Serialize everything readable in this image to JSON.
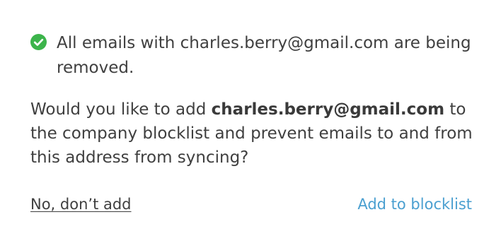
{
  "status": {
    "icon": "check-circle-icon",
    "icon_color": "#3cb44b",
    "message": "All emails with charles.berry@gmail.com are being removed."
  },
  "prompt": {
    "prefix": "Would you like to add ",
    "email": "charles.berry@gmail.com",
    "suffix": " to the company blocklist and prevent emails to and from this address from syncing?"
  },
  "actions": {
    "decline_label": "No, don’t add",
    "accept_label": "Add to blocklist",
    "accept_color": "#4a9fd0"
  }
}
